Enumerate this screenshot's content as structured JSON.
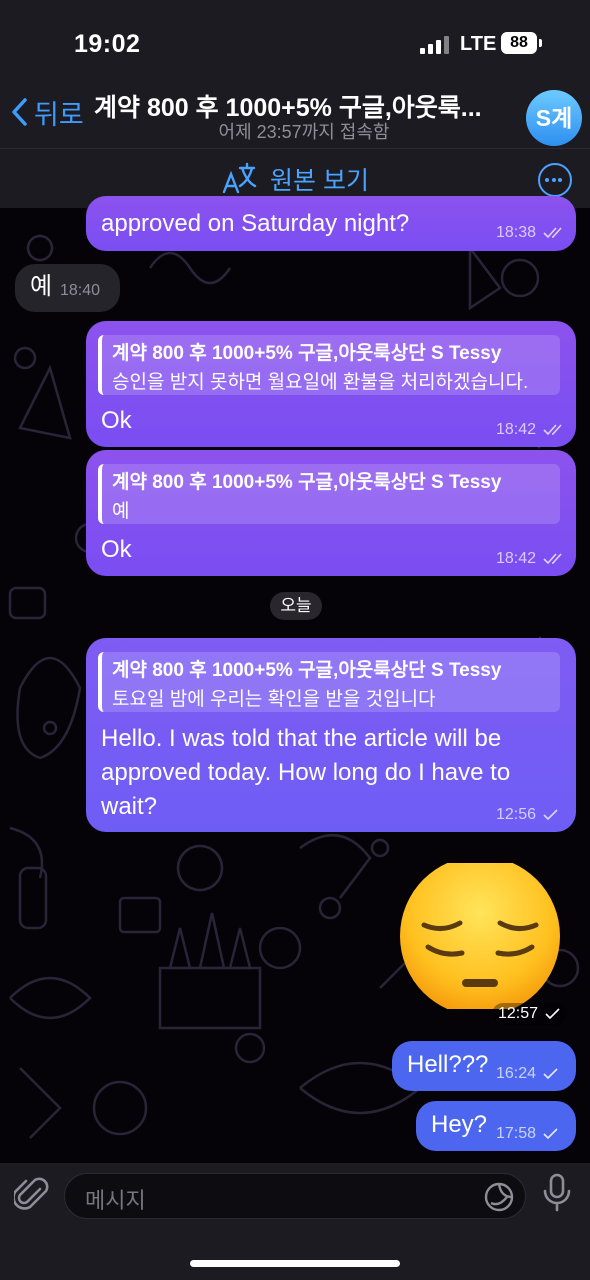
{
  "status_bar": {
    "time": "19:02",
    "network": "LTE",
    "battery": "88"
  },
  "header": {
    "back_label": "뒤로",
    "title": "계약 800 후 1000+5% 구글,아웃룩...",
    "subtitle": "어제 23:57까지 접속함",
    "avatar_text": "S계"
  },
  "translate_bar": {
    "label": "원본 보기",
    "icon": "translate-icon",
    "more_icon": "more-icon"
  },
  "messages": [
    {
      "direction": "out",
      "text": "approved on Saturday night?",
      "time": "18:38",
      "status": "read"
    },
    {
      "direction": "in",
      "text": "예",
      "time": "18:40"
    },
    {
      "direction": "out",
      "reply_name": "계약 800 후 1000+5% 구글,아웃룩상단 S Tessy",
      "reply_text": "승인을 받지 못하면 월요일에 환불을 처리하겠습니다.",
      "text": "Ok",
      "time": "18:42",
      "status": "read"
    },
    {
      "direction": "out",
      "reply_name": "계약 800 후 1000+5% 구글,아웃룩상단 S Tessy",
      "reply_text": "예",
      "text": "Ok",
      "time": "18:42",
      "status": "read"
    },
    {
      "direction": "out",
      "reply_name": "계약 800 후 1000+5% 구글,아웃룩상단 S Tessy",
      "reply_text": "토요일 밤에 우리는 확인을 받을 것입니다",
      "text_lines": [
        "Hello. I was told that the article will be",
        "approved today. How long do I have to",
        "wait?"
      ],
      "time": "12:56",
      "status": "sent"
    },
    {
      "direction": "out",
      "emoji": "pensive-face",
      "time": "12:57",
      "status": "sent"
    },
    {
      "direction": "out",
      "text": "Hell???",
      "time": "16:24",
      "status": "sent"
    },
    {
      "direction": "out",
      "text": "Hey?",
      "time": "17:58",
      "status": "sent"
    }
  ],
  "date_separator": "오늘",
  "input": {
    "placeholder": "메시지"
  },
  "colors": {
    "accent": "#3f9cff",
    "bubble_purple": "#8a52ee",
    "bubble_blue": "#4c66f0",
    "bubble_incoming": "#26242b",
    "bar_background": "#1c1b22"
  }
}
